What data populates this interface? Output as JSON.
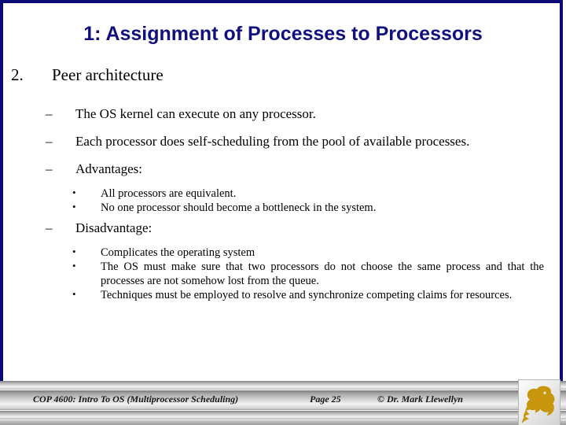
{
  "slide": {
    "title": "1: Assignment of Processes to Processors",
    "accent_color": "#11117e",
    "border_color": "#0b0b78",
    "logo_color": "#c8960c"
  },
  "content": {
    "item_number": "2.",
    "item_text": "Peer architecture",
    "dash_glyph": "–",
    "dot_glyph": "•",
    "sub_bullets": [
      "The OS kernel can execute on any processor.",
      "Each processor does self-scheduling from the pool of available processes.",
      "Advantages:",
      "Disadvantage:"
    ],
    "advantages": [
      "All processors are equivalent.",
      "No one processor should become a bottleneck in the system."
    ],
    "disadvantages": [
      "Complicates the operating system",
      "The OS must make sure that two processors do not choose the same process and that the processes are not somehow lost from the queue.",
      "Techniques must be employed to resolve and synchronize competing claims for resources."
    ]
  },
  "footer": {
    "course": "COP 4600: Intro To OS  (Multiprocessor Scheduling)",
    "page": "Page 25",
    "copyright": "© Dr. Mark Llewellyn",
    "logo_name": "pegasus-logo"
  }
}
